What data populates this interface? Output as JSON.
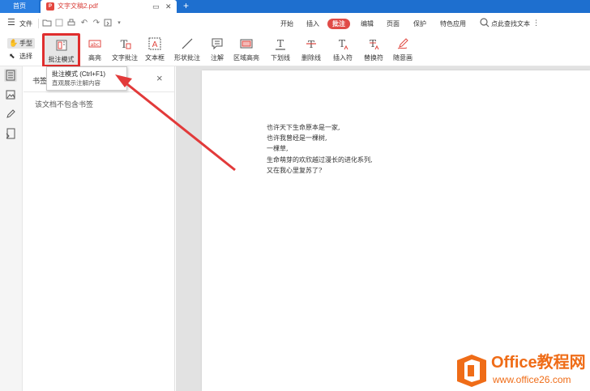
{
  "tabs": {
    "home": "首页",
    "doc": "文字文稿2.pdf",
    "pdf_badge": "P",
    "add": "+"
  },
  "menubar": {
    "file": "文件",
    "items": [
      "开始",
      "插入",
      "批注",
      "编辑",
      "页面",
      "保护",
      "特色应用"
    ],
    "active": "批注",
    "search": "点此查找文本"
  },
  "toolbar": {
    "hand": "手型",
    "select": "选择",
    "tools": [
      {
        "label": "批注模式",
        "icon": "annotation-mode-icon"
      },
      {
        "label": "高亮",
        "icon": "highlight-icon"
      },
      {
        "label": "文字批注",
        "icon": "text-annotation-icon"
      },
      {
        "label": "文本框",
        "icon": "textbox-icon"
      },
      {
        "label": "形状批注",
        "icon": "shape-annotation-icon"
      },
      {
        "label": "注解",
        "icon": "note-icon"
      },
      {
        "label": "区域高亮",
        "icon": "area-highlight-icon"
      },
      {
        "label": "下划线",
        "icon": "underline-icon"
      },
      {
        "label": "删除线",
        "icon": "strikethrough-icon"
      },
      {
        "label": "插入符",
        "icon": "insert-caret-icon"
      },
      {
        "label": "替换符",
        "icon": "replace-caret-icon"
      },
      {
        "label": "随意画",
        "icon": "freehand-draw-icon"
      }
    ]
  },
  "tooltip": {
    "title": "批注模式 (Ctrl+F1)",
    "desc": "直观展示注解内容"
  },
  "bookmarks": {
    "title": "书签",
    "empty": "该文档不包含书签"
  },
  "document": {
    "lines": [
      "也许天下生命原本是一家,",
      "也许我曾经是一棵树,",
      "一棵草,",
      "生命萌芽的欢欣越过漫长的进化系列,",
      "又在我心里复苏了?"
    ]
  },
  "watermark": {
    "brand": "Office教程网",
    "url": "www.office26.com"
  },
  "colors": {
    "tabbar": "#1e6fcf",
    "active_tab": "#e04b47",
    "highlight_box": "#e02e2e",
    "watermark": "#ef6c17"
  }
}
